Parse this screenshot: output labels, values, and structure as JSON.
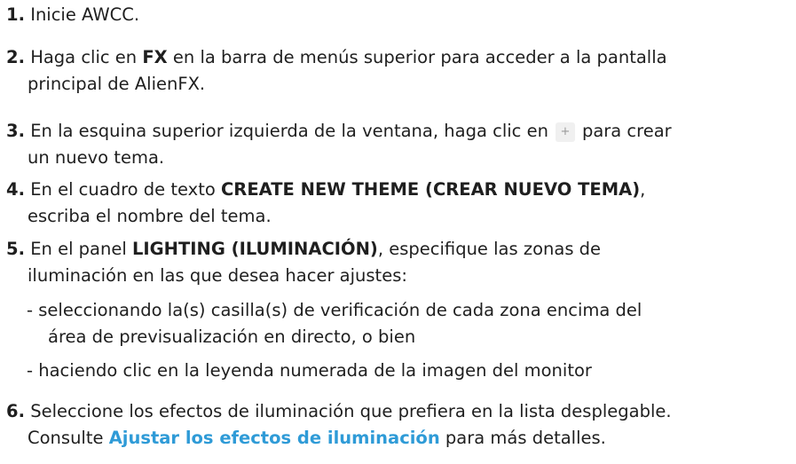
{
  "steps": [
    {
      "num": "1.",
      "text": "Inicie AWCC."
    },
    {
      "num": "2.",
      "pre": "Haga clic en ",
      "bold": "FX",
      "post": " en la barra de menús superior para acceder a la pantalla",
      "line2": "principal de AlienFX."
    },
    {
      "num": "3.",
      "pre": "En la esquina superior izquierda de la ventana, haga clic en",
      "icon": "+",
      "post": "para crear",
      "line2": "un nuevo tema."
    },
    {
      "num": "4.",
      "pre": "En el cuadro de texto ",
      "bold": "CREATE NEW THEME (CREAR NUEVO TEMA)",
      "post": ",",
      "line2": "escriba el nombre del tema."
    },
    {
      "num": "5.",
      "pre": "En el panel ",
      "bold": "LIGHTING (ILUMINACIÓN)",
      "post": ", especifique las zonas de",
      "line2": "iluminación en las que desea hacer ajustes:"
    },
    {
      "num": "6.",
      "text": "Seleccione los efectos de iluminación que prefiera en la lista desplegable.",
      "line2_pre": "Consulte ",
      "link": "Ajustar los efectos de iluminación",
      "line2_post": " para más detalles."
    }
  ],
  "substeps": [
    {
      "dash": "-",
      "line1": "seleccionando la(s) casilla(s) de verificación de cada zona encima del",
      "line2": "área de previsualización en directo, o bien"
    },
    {
      "dash": "-",
      "line1": "haciendo clic en la leyenda numerada de la imagen del monitor"
    }
  ],
  "colors": {
    "link": "#2f9bd7",
    "text": "#1f1f1f"
  }
}
